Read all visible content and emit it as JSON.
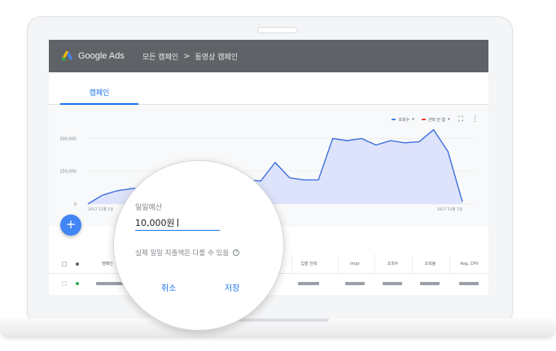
{
  "app": {
    "logo_text": "Google Ads",
    "breadcrumb": {
      "all_campaigns": "모든 캠페인",
      "separator": ">",
      "current": "동영상 캠페인"
    }
  },
  "tabs": [
    {
      "label": "캠페인",
      "active": true
    }
  ],
  "chart": {
    "legend": [
      {
        "label": "조회수",
        "color": "#4285f4"
      },
      {
        "label": "선택 안 함",
        "color": "#ea4335"
      }
    ],
    "y_ticks": [
      "300,000",
      "150,000",
      "0"
    ],
    "x_start_label": "2017 11월 1일",
    "x_end_label": "2017 12월 1일"
  },
  "chart_data": {
    "type": "area",
    "series": [
      {
        "name": "조회수",
        "values": [
          0,
          40000,
          60000,
          70000,
          75000,
          80000,
          85000,
          90000,
          95000,
          95000,
          100000,
          110000,
          105000,
          190000,
          120000,
          110000,
          110000,
          300000,
          290000,
          300000,
          270000,
          290000,
          280000,
          285000,
          340000,
          240000,
          10000
        ]
      }
    ],
    "ylim": [
      0,
      350000
    ],
    "grid": true
  },
  "fab": {
    "label": "+"
  },
  "table": {
    "headers": [
      "캠페인",
      "입찰 전략",
      "Impr.",
      "조회수",
      "조회율",
      "Avg. CPV"
    ]
  },
  "dialog": {
    "label": "일일예산",
    "value": "10,000원",
    "hint": "실제 일일 지출액은 다를 수 있음",
    "cancel": "취소",
    "save": "저장"
  },
  "colors": {
    "accent": "#1a73e8",
    "topbar": "#5f6368",
    "series_line": "#3d6fdd",
    "series_fill": "#dde3fb"
  }
}
